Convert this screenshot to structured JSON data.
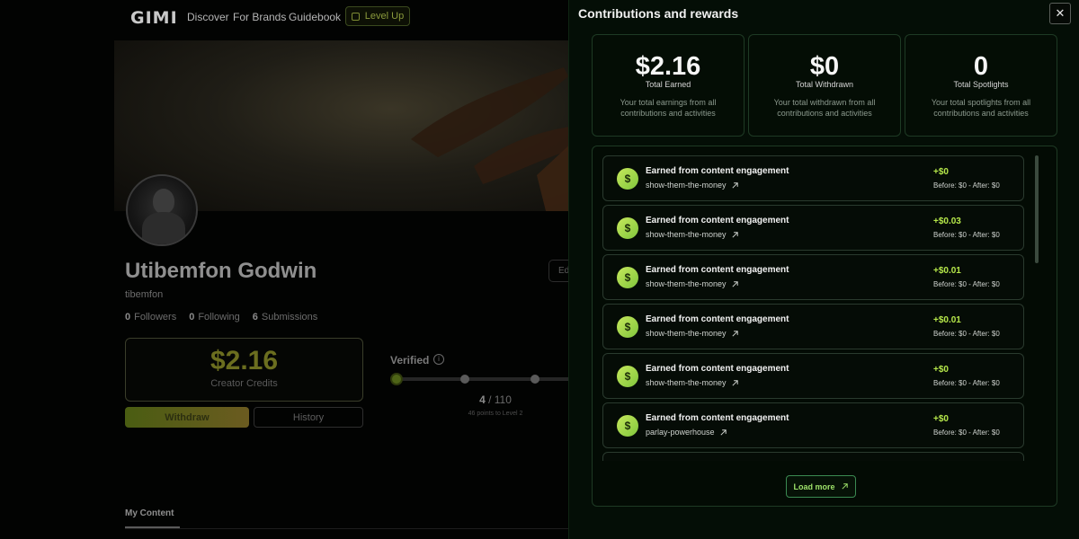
{
  "topnav": {
    "logo": "GIMI",
    "links": [
      "Discover",
      "For Brands",
      "Guidebook"
    ],
    "level_up": "Level Up"
  },
  "profile": {
    "name": "Utibemfon Godwin",
    "handle": "tibemfon",
    "followers": "0",
    "followers_label": "Followers",
    "following": "0",
    "following_label": "Following",
    "submissions": "6",
    "submissions_label": "Submissions",
    "edit_label": "Ed"
  },
  "credits": {
    "amount": "$2.16",
    "label": "Creator Credits",
    "withdraw": "Withdraw",
    "history": "History"
  },
  "level": {
    "verified": "Verified",
    "points": "4",
    "total": "/ 110",
    "sub": "46 points to Level 2",
    "progress": 0.036
  },
  "content_tab": "My Content",
  "drawer": {
    "title": "Contributions and rewards",
    "summary": [
      {
        "value": "$2.16",
        "label": "Total Earned",
        "desc": "Your total earnings from all contributions and activities"
      },
      {
        "value": "$0",
        "label": "Total Withdrawn",
        "desc": "Your total withdrawn from all contributions and activities"
      },
      {
        "value": "0",
        "label": "Total Spotlights",
        "desc": "Your total spotlights from all contributions and activities"
      }
    ],
    "entries": [
      {
        "title": "Earned from content engagement",
        "slug": "show-them-the-money",
        "amount": "+$0",
        "balance": "Before: $0 - After: $0"
      },
      {
        "title": "Earned from content engagement",
        "slug": "show-them-the-money",
        "amount": "+$0.03",
        "balance": "Before: $0 - After: $0"
      },
      {
        "title": "Earned from content engagement",
        "slug": "show-them-the-money",
        "amount": "+$0.01",
        "balance": "Before: $0 - After: $0"
      },
      {
        "title": "Earned from content engagement",
        "slug": "show-them-the-money",
        "amount": "+$0.01",
        "balance": "Before: $0 - After: $0"
      },
      {
        "title": "Earned from content engagement",
        "slug": "show-them-the-money",
        "amount": "+$0",
        "balance": "Before: $0 - After: $0"
      },
      {
        "title": "Earned from content engagement",
        "slug": "parlay-powerhouse",
        "amount": "+$0",
        "balance": "Before: $0 - After: $0"
      }
    ],
    "load_more": "Load more"
  },
  "icons": {
    "close": "close-icon",
    "coin": "dollar-coin-icon",
    "external": "external-link-icon",
    "info": "info-icon",
    "level": "level-up-icon"
  },
  "colors": {
    "accent_green": "#b6e84a",
    "drawer_bg": "#040e06",
    "card_border": "#1e3a24",
    "button_border": "#3b8a52"
  }
}
